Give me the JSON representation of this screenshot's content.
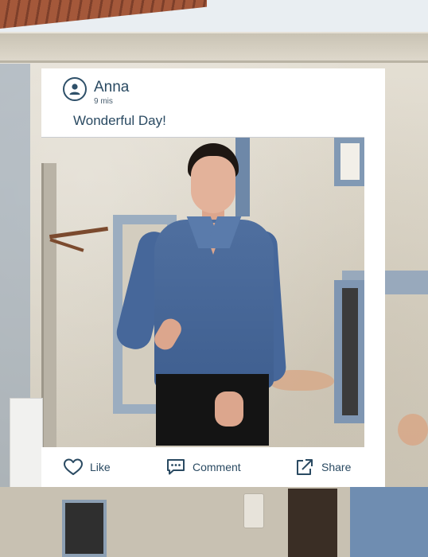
{
  "post": {
    "user_name": "Anna",
    "time_ago": "9 mis",
    "caption": "Wonderful Day!"
  },
  "actions": {
    "like_label": "Like",
    "comment_label": "Comment",
    "share_label": "Share"
  },
  "icons": {
    "avatar": "user-avatar-icon",
    "like": "heart-outline-icon",
    "comment": "speech-bubble-dots-icon",
    "share": "share-arrow-icon"
  },
  "colors": {
    "text_primary": "#2a4a62",
    "card_background": "#ffffff",
    "sweater": "#4a6a9c"
  }
}
